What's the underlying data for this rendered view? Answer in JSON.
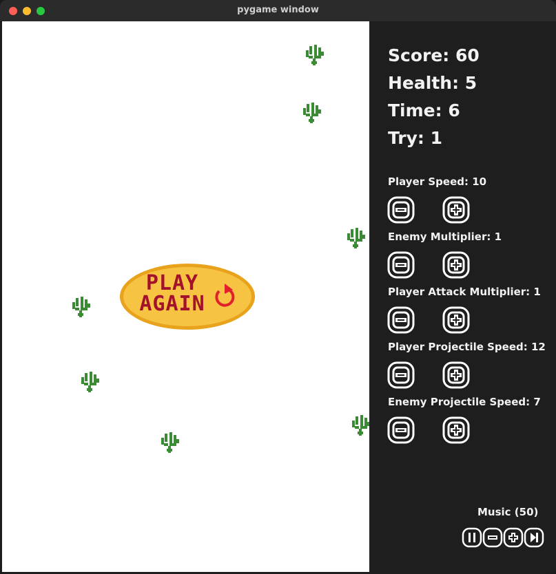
{
  "window": {
    "title": "pygame window"
  },
  "stats": {
    "score": "Score: 60",
    "health": "Health: 5",
    "time": "Time: 6",
    "try": "Try: 1"
  },
  "settings": [
    {
      "label": "Player Speed: 10"
    },
    {
      "label": "Enemy Multiplier: 1"
    },
    {
      "label": "Player Attack Multiplier: 1"
    },
    {
      "label": "Player Projectile Speed: 12"
    },
    {
      "label": "Enemy Projectile Speed: 7"
    }
  ],
  "music": {
    "label": "Music (50)"
  },
  "play_again": {
    "line1": "PLAY",
    "line2": "AGAIN"
  },
  "colors": {
    "panel": "#1e1e1e",
    "field": "#ffffff",
    "plant": "#3b8a34",
    "play_fill": "#f6c343",
    "play_border": "#e8a21c",
    "play_text": "#a3122a",
    "restart_icon": "#e2202c"
  },
  "icons": {
    "minus": "minus-icon",
    "plus": "plus-icon",
    "pause": "pause-icon",
    "next": "skip-next-icon",
    "restart": "restart-icon",
    "plant": "grass-tuft-icon"
  }
}
